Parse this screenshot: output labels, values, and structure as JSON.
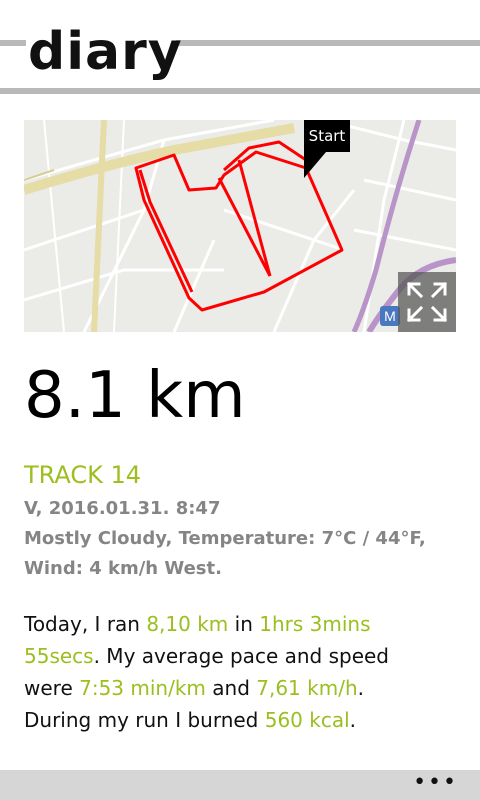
{
  "app": {
    "title": "diary"
  },
  "map": {
    "start_label": "Start",
    "route_color": "#ff0000",
    "expand_icon": "expand-arrows-icon"
  },
  "track": {
    "distance": "8.1 km",
    "name": "TRACK 14",
    "date": "V, 2016.01.31. 8:47",
    "weather_line1": "Mostly Cloudy, Temperature: 7°C / 44°F,",
    "weather_line2": "Wind: 4 km/h West."
  },
  "summary": {
    "t1": "Today, I ran ",
    "distance": "8,10 km",
    "t2": " in ",
    "duration_a": "1hrs 3mins",
    "duration_b": "55secs",
    "t3": ". My average pace and speed",
    "t4": "were ",
    "pace": "7:53 min/km",
    "t5": " and ",
    "speed": "7,61 km/h",
    "t6": ".",
    "t7": "During my run I burned ",
    "calories": "560 kcal",
    "t8": "."
  },
  "appbar": {
    "more": "•••"
  },
  "colors": {
    "accent": "#9cbe1f",
    "meta_text": "#858585"
  }
}
